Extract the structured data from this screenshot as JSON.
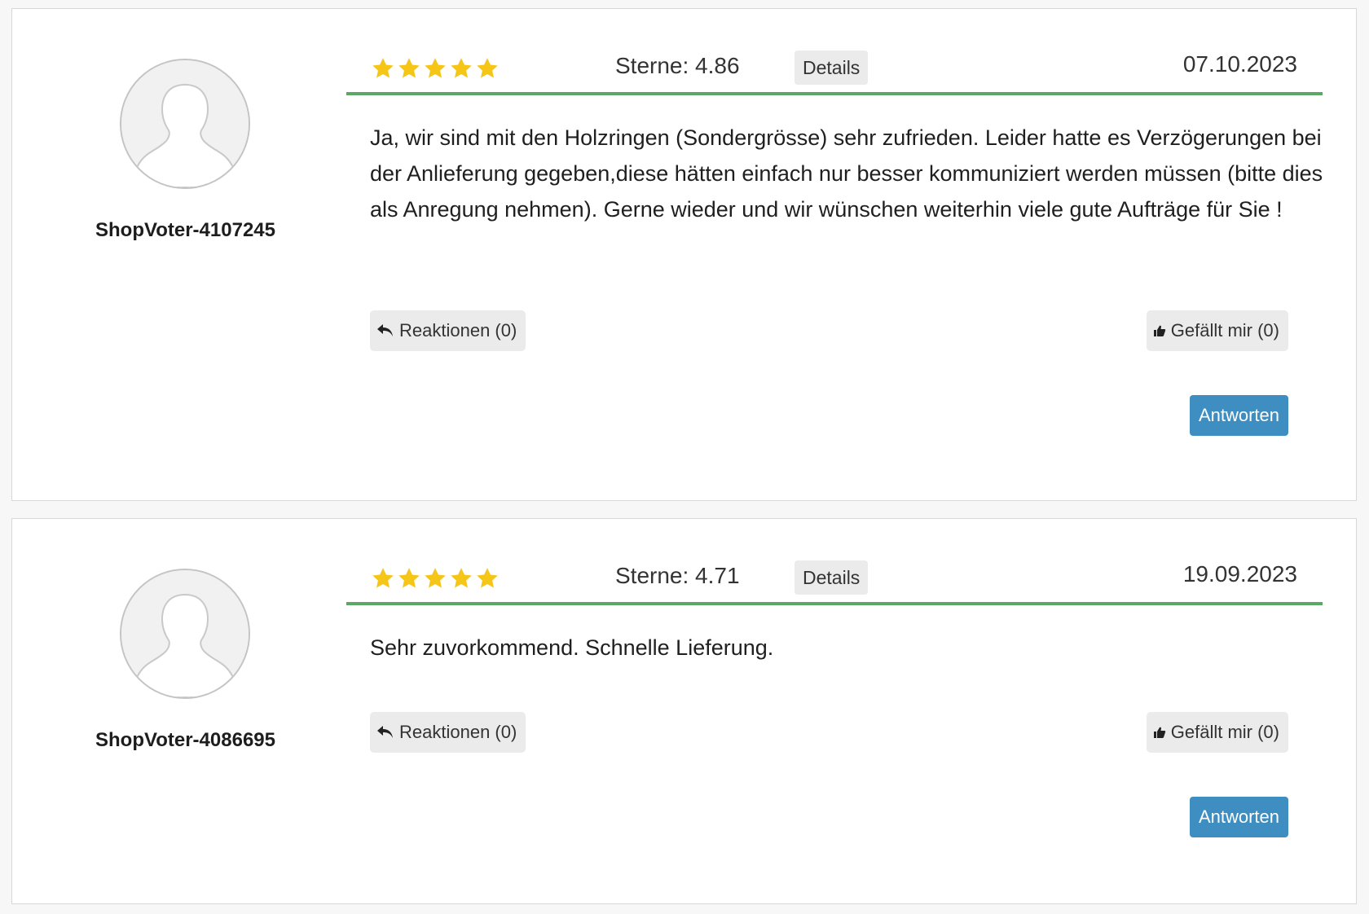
{
  "colors": {
    "accent_line": "#5aa864",
    "star_fill": "#f5c518",
    "answer_button": "#3f8ec1"
  },
  "reviews": [
    {
      "author": "ShopVoter-4107245",
      "rating_stars": 5,
      "score_label": "Sterne: 4.86",
      "details_label": "Details",
      "date": "07.10.2023",
      "text": "Ja, wir sind mit den Holzringen (Sondergrösse) sehr zufrieden. Leider hatte es Verzögerungen bei der Anlieferung gegeben,diese hätten einfach nur besser kommuniziert werden müssen (bitte dies als Anregung nehmen). Gerne wieder und wir wünschen weiterhin viele gute Aufträge für Sie !",
      "reactions_label": "Reaktionen (0)",
      "like_label": "Gefällt mir (0)",
      "answer_label": "Antworten"
    },
    {
      "author": "ShopVoter-4086695",
      "rating_stars": 5,
      "score_label": "Sterne: 4.71",
      "details_label": "Details",
      "date": "19.09.2023",
      "text": "Sehr zuvorkommend. Schnelle Lieferung.",
      "reactions_label": "Reaktionen (0)",
      "like_label": "Gefällt mir (0)",
      "answer_label": "Antworten"
    }
  ],
  "icons": {
    "avatar": "user-silhouette-icon",
    "star": "star-icon",
    "reactions": "reply-arrow-icon",
    "like": "thumbs-up-icon"
  }
}
